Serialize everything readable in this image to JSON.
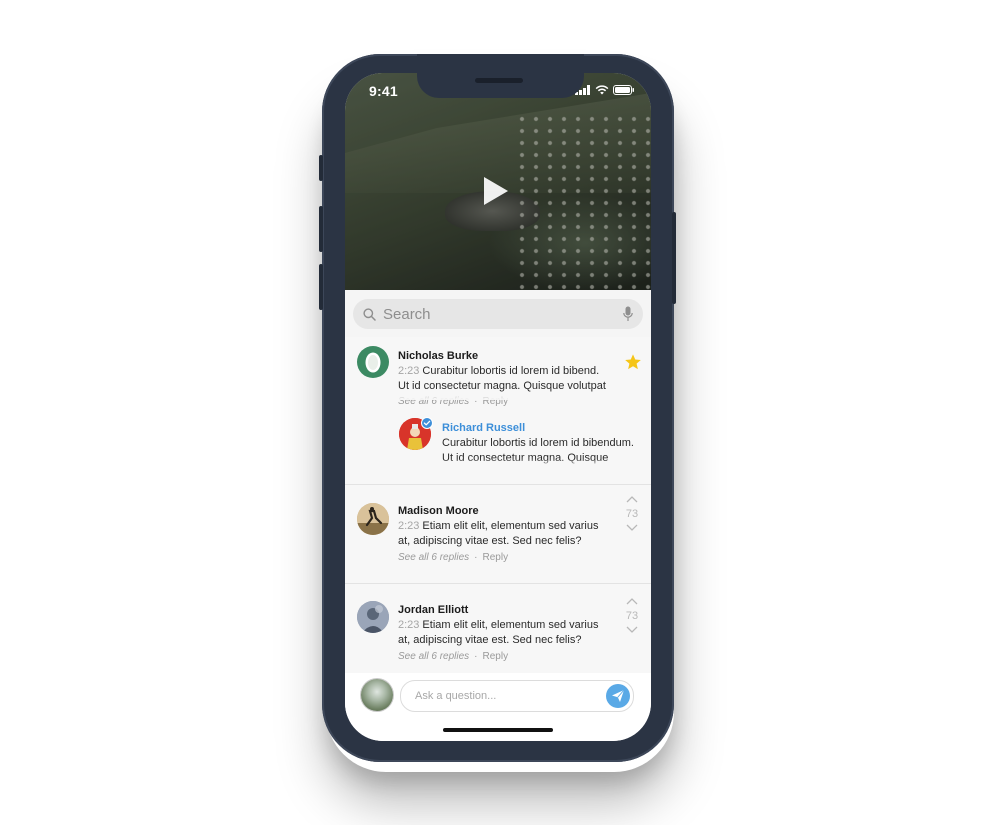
{
  "status_bar": {
    "time": "9:41"
  },
  "video": {
    "play_icon": "play-icon"
  },
  "search": {
    "placeholder": "Search",
    "search_icon": "search-icon",
    "mic_icon": "microphone-icon"
  },
  "comments": [
    {
      "author": "Nicholas Burke",
      "time": "2:23",
      "text": "Curabitur lobortis id lorem id bibend. Ut id consectetur magna. Quisque volutpat",
      "see_replies": "See all 6 replies",
      "separator": "·",
      "reply": "Reply",
      "starred": true,
      "star_color": "#f5c518",
      "avatar_color": "#3c8a63",
      "replies": [
        {
          "author": "Richard Russell",
          "text": "Curabitur lobortis id lorem id bibendum. Ut id consectetur magna. Quisque",
          "verified": true,
          "author_color": "#3d8fd9"
        }
      ]
    },
    {
      "author": "Madison Moore",
      "time": "2:23",
      "text": "Etiam elit elit, elementum sed varius at, adipiscing vitae est. Sed nec felis?",
      "see_replies": "See all 6 replies",
      "separator": "·",
      "reply": "Reply",
      "votes": "73"
    },
    {
      "author": "Jordan Elliott",
      "time": "2:23",
      "text": "Etiam elit elit, elementum sed varius at, adipiscing vitae est. Sed nec felis?",
      "see_replies": "See all 6 replies",
      "separator": "·",
      "reply": "Reply",
      "votes": "73"
    }
  ],
  "composer": {
    "placeholder": "Ask a question...",
    "send_icon": "send-icon",
    "accent": "#5aa9e6"
  }
}
